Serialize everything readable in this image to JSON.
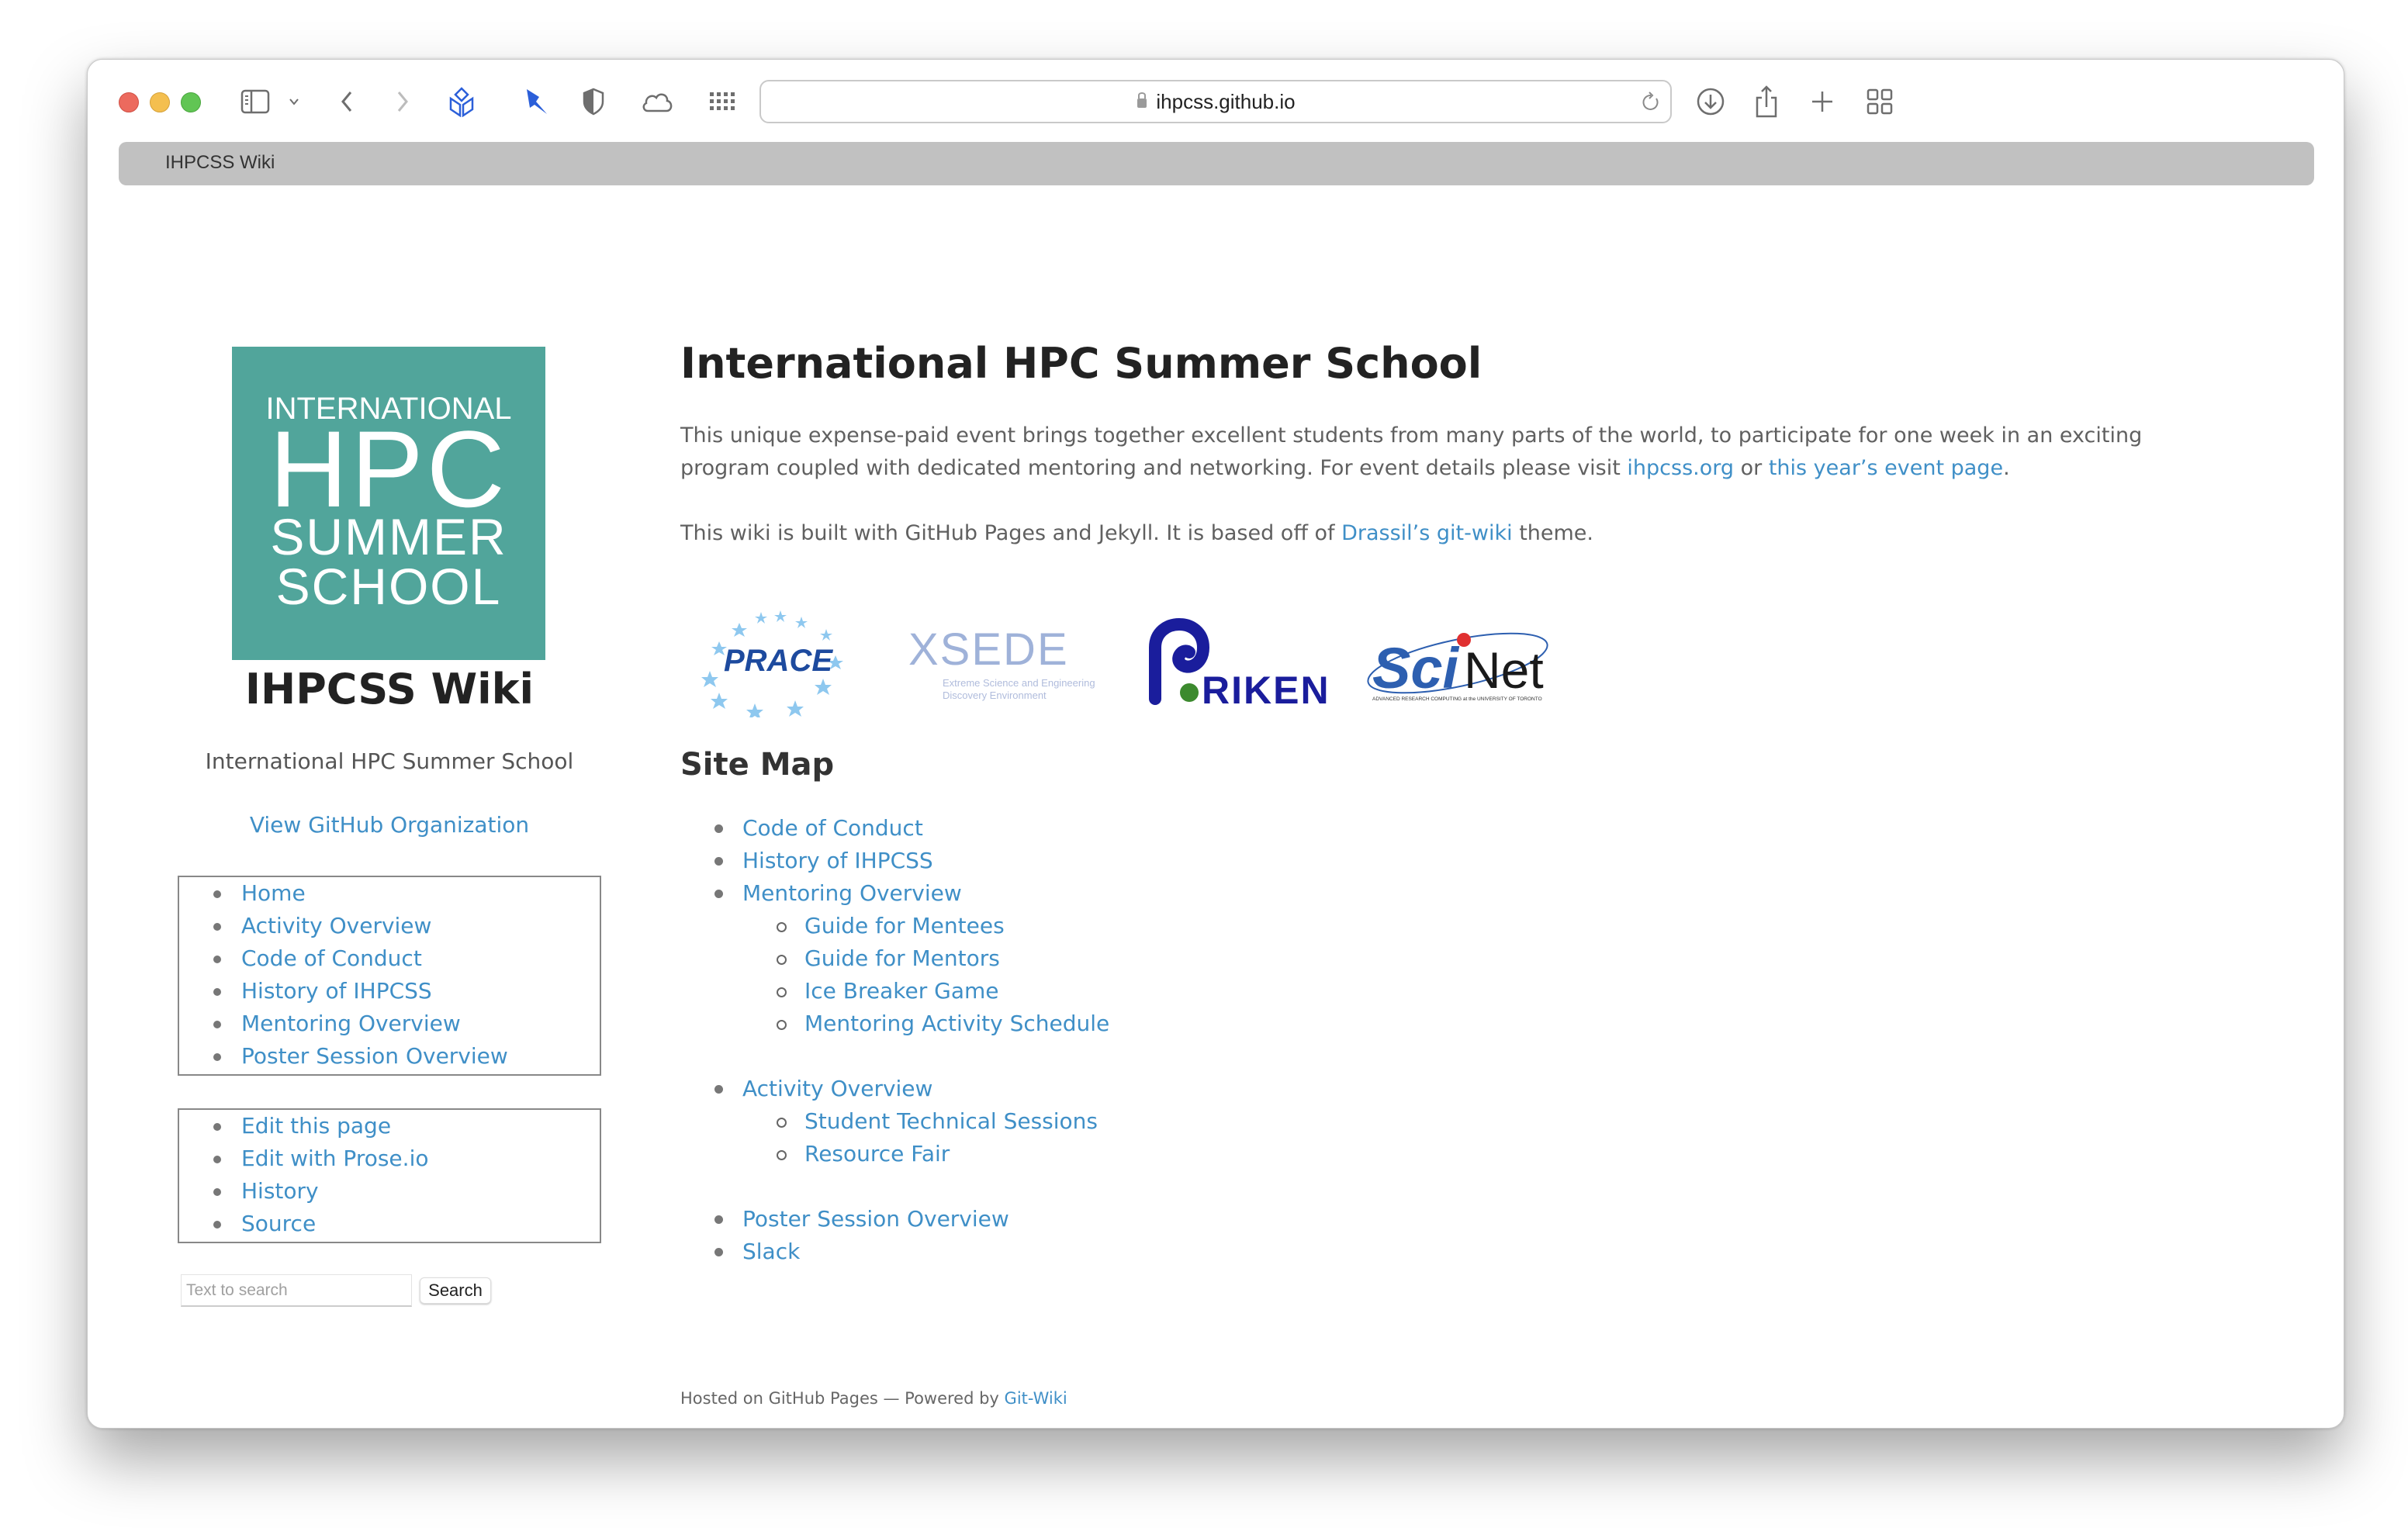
{
  "browser": {
    "url": "ihpcss.github.io",
    "tab_title": "IHPCSS Wiki",
    "toolbar_icons": [
      "sidebar-icon",
      "chevron-down-icon",
      "back-icon",
      "forward-icon",
      "extension-cube-icon",
      "pin-icon",
      "shield-icon",
      "cloud-icon",
      "grid-dots-icon",
      "lock-icon",
      "reload-icon",
      "download-icon",
      "share-icon",
      "new-tab-plus-icon",
      "tab-overview-icon"
    ]
  },
  "sidebar": {
    "logo": {
      "line1": "INTERNATIONAL",
      "line2": "HPC",
      "line3": "SUMMER",
      "line4": "SCHOOL",
      "color": "#51a59b"
    },
    "title": "IHPCSS Wiki",
    "subtitle": "International HPC Summer School",
    "github_link": "View GitHub Organization",
    "nav": [
      {
        "label": "Home"
      },
      {
        "label": "Activity Overview"
      },
      {
        "label": "Code of Conduct"
      },
      {
        "label": "History of IHPCSS"
      },
      {
        "label": "Mentoring Overview"
      },
      {
        "label": "Poster Session Overview"
      }
    ],
    "tools": [
      {
        "label": "Edit this page"
      },
      {
        "label": "Edit with Prose.io"
      },
      {
        "label": "History"
      },
      {
        "label": "Source"
      }
    ],
    "search": {
      "placeholder": "Text to search",
      "value": "",
      "button": "Search"
    }
  },
  "main": {
    "title": "International HPC Summer School",
    "intro": {
      "text1": "This unique expense-paid event brings together excellent students from many parts of the world, to participate for one week in an exciting program coupled with dedicated mentoring and networking. For event details please visit ",
      "link1": "ihpcss.org",
      "text2": " or ",
      "link2": "this year’s event page",
      "text3": "."
    },
    "built": {
      "text1": "This wiki is built with GitHub Pages and Jekyll. It is based off of ",
      "link": "Drassil’s git-wiki",
      "text2": " theme."
    },
    "partners": [
      {
        "name": "PRACE"
      },
      {
        "name": "XSEDE",
        "tagline1": "Extreme Science and Engineering",
        "tagline2": "Discovery Environment"
      },
      {
        "name": "RIKEN"
      },
      {
        "name": "SciNet",
        "tagline": "ADVANCED RESEARCH COMPUTING at the UNIVERSITY OF TORONTO"
      }
    ],
    "sitemap_title": "Site Map",
    "sitemap": [
      {
        "label": "Code of Conduct",
        "children": []
      },
      {
        "label": "History of IHPCSS",
        "children": []
      },
      {
        "label": "Mentoring Overview",
        "children": [
          {
            "label": "Guide for Mentees"
          },
          {
            "label": "Guide for Mentors"
          },
          {
            "label": "Ice Breaker Game"
          },
          {
            "label": "Mentoring Activity Schedule"
          }
        ]
      },
      {
        "label": "Activity Overview",
        "children": [
          {
            "label": "Student Technical Sessions"
          },
          {
            "label": "Resource Fair"
          }
        ]
      },
      {
        "label": "Poster Session Overview",
        "children": []
      },
      {
        "label": "Slack",
        "children": []
      }
    ],
    "footer": {
      "text": "Hosted on GitHub Pages — Powered by ",
      "link": "Git-Wiki"
    }
  },
  "colors": {
    "link": "#3f8fc7",
    "text": "#606060",
    "heading": "#222222",
    "tab_bar": "#c1c1c1"
  }
}
